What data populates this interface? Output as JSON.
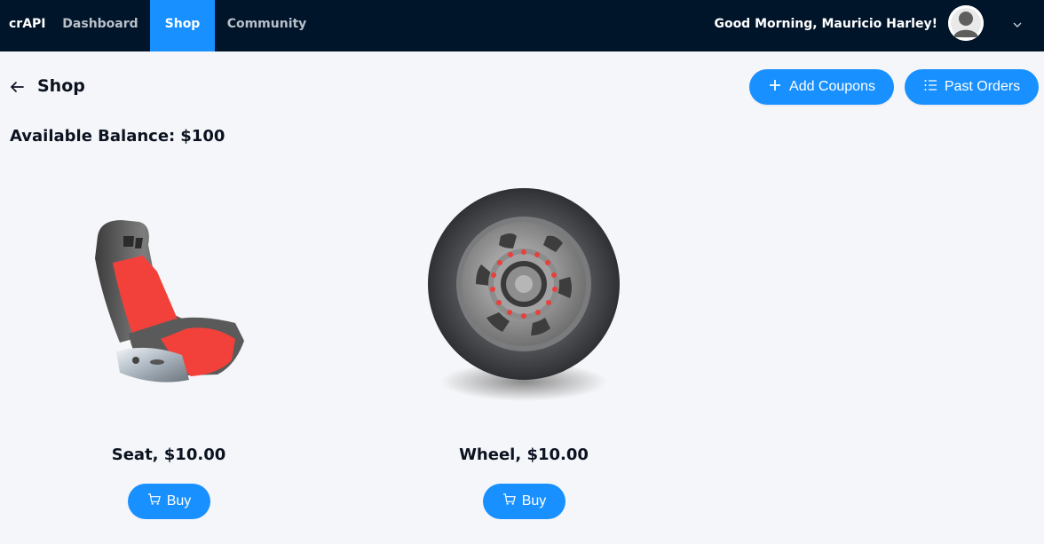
{
  "nav": {
    "brand": "crAPI",
    "items": [
      {
        "label": "Dashboard"
      },
      {
        "label": "Shop",
        "active": true
      },
      {
        "label": "Community"
      }
    ],
    "greeting": "Good Morning, Mauricio Harley!",
    "avatar_icon": "user-avatar-icon",
    "menu_icon": "chevron-down-icon"
  },
  "page": {
    "title": "Shop",
    "back_icon": "arrow-left-icon",
    "add_coupons_label": "Add Coupons",
    "add_coupons_icon": "plus-icon",
    "past_orders_label": "Past Orders",
    "past_orders_icon": "list-icon"
  },
  "balance": {
    "label": "Available Balance:",
    "amount": "$100"
  },
  "products": [
    {
      "name": "Seat, $10.00",
      "image": "car-seat-image",
      "buy_label": "Buy",
      "buy_icon": "shopping-cart-icon"
    },
    {
      "name": "Wheel, $10.00",
      "image": "car-wheel-image",
      "buy_label": "Buy",
      "buy_icon": "shopping-cart-icon"
    }
  ],
  "colors": {
    "nav_bg": "#00142a",
    "accent": "#1890ff",
    "page_bg": "#f5f6f9",
    "seat_red": "#f2413a"
  }
}
